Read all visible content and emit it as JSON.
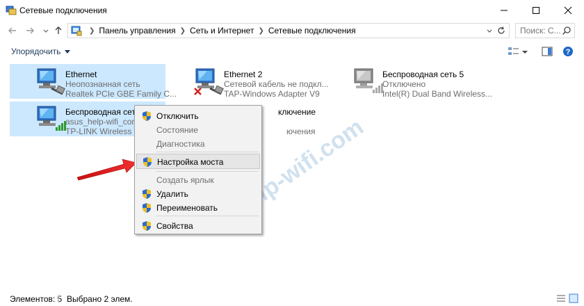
{
  "window": {
    "title": "Сетевые подключения",
    "minimize": "minimize",
    "maximize": "maximize",
    "close": "close"
  },
  "address": {
    "breadcrumbs": [
      "Панель управления",
      "Сеть и Интернет",
      "Сетевые подключения"
    ],
    "search_placeholder": "Поиск: С..."
  },
  "commandbar": {
    "organize_label": "Упорядочить"
  },
  "items": [
    {
      "name": "Ethernet",
      "status": "Неопознанная сеть",
      "adapter": "Realtek PCIe GBE Family C...",
      "icon": "ethernet-icon",
      "state": "connected"
    },
    {
      "name": "Ethernet 2",
      "status": "Сетевой кабель не подкл...",
      "adapter": "TAP-Windows Adapter V9",
      "icon": "ethernet-icon",
      "state": "disconnected"
    },
    {
      "name": "Беспроводная сеть 5",
      "status": "Отключено",
      "adapter": "Intel(R) Dual Band Wireless...",
      "icon": "wireless-icon",
      "state": "disabled"
    },
    {
      "name": "Беспроводная сеть",
      "status": "asus_help-wifi_com",
      "adapter": "TP-LINK Wireless US",
      "icon": "wireless-icon",
      "state": "connected"
    },
    {
      "name_fragment": "ключение",
      "status_fragment": "ючения"
    }
  ],
  "context_menu": {
    "items": [
      {
        "label": "Отключить",
        "shield": true,
        "disabled": false
      },
      {
        "label": "Состояние",
        "shield": false,
        "disabled": true
      },
      {
        "label": "Диагностика",
        "shield": false,
        "disabled": true
      },
      {
        "label": "Настройка моста",
        "shield": true,
        "disabled": false,
        "hover": true
      },
      {
        "label": "Создать ярлык",
        "shield": false,
        "disabled": true
      },
      {
        "label": "Удалить",
        "shield": true,
        "disabled": false
      },
      {
        "label": "Переименовать",
        "shield": true,
        "disabled": false
      },
      {
        "label": "Свойства",
        "shield": true,
        "disabled": false
      }
    ]
  },
  "watermark": "help-wifi.com",
  "status": {
    "count": "Элементов: 5",
    "selected": "Выбрано 2 элем."
  },
  "colors": {
    "selection": "#cce8ff",
    "accent": "#1e395b",
    "arrow": "#e02020"
  }
}
